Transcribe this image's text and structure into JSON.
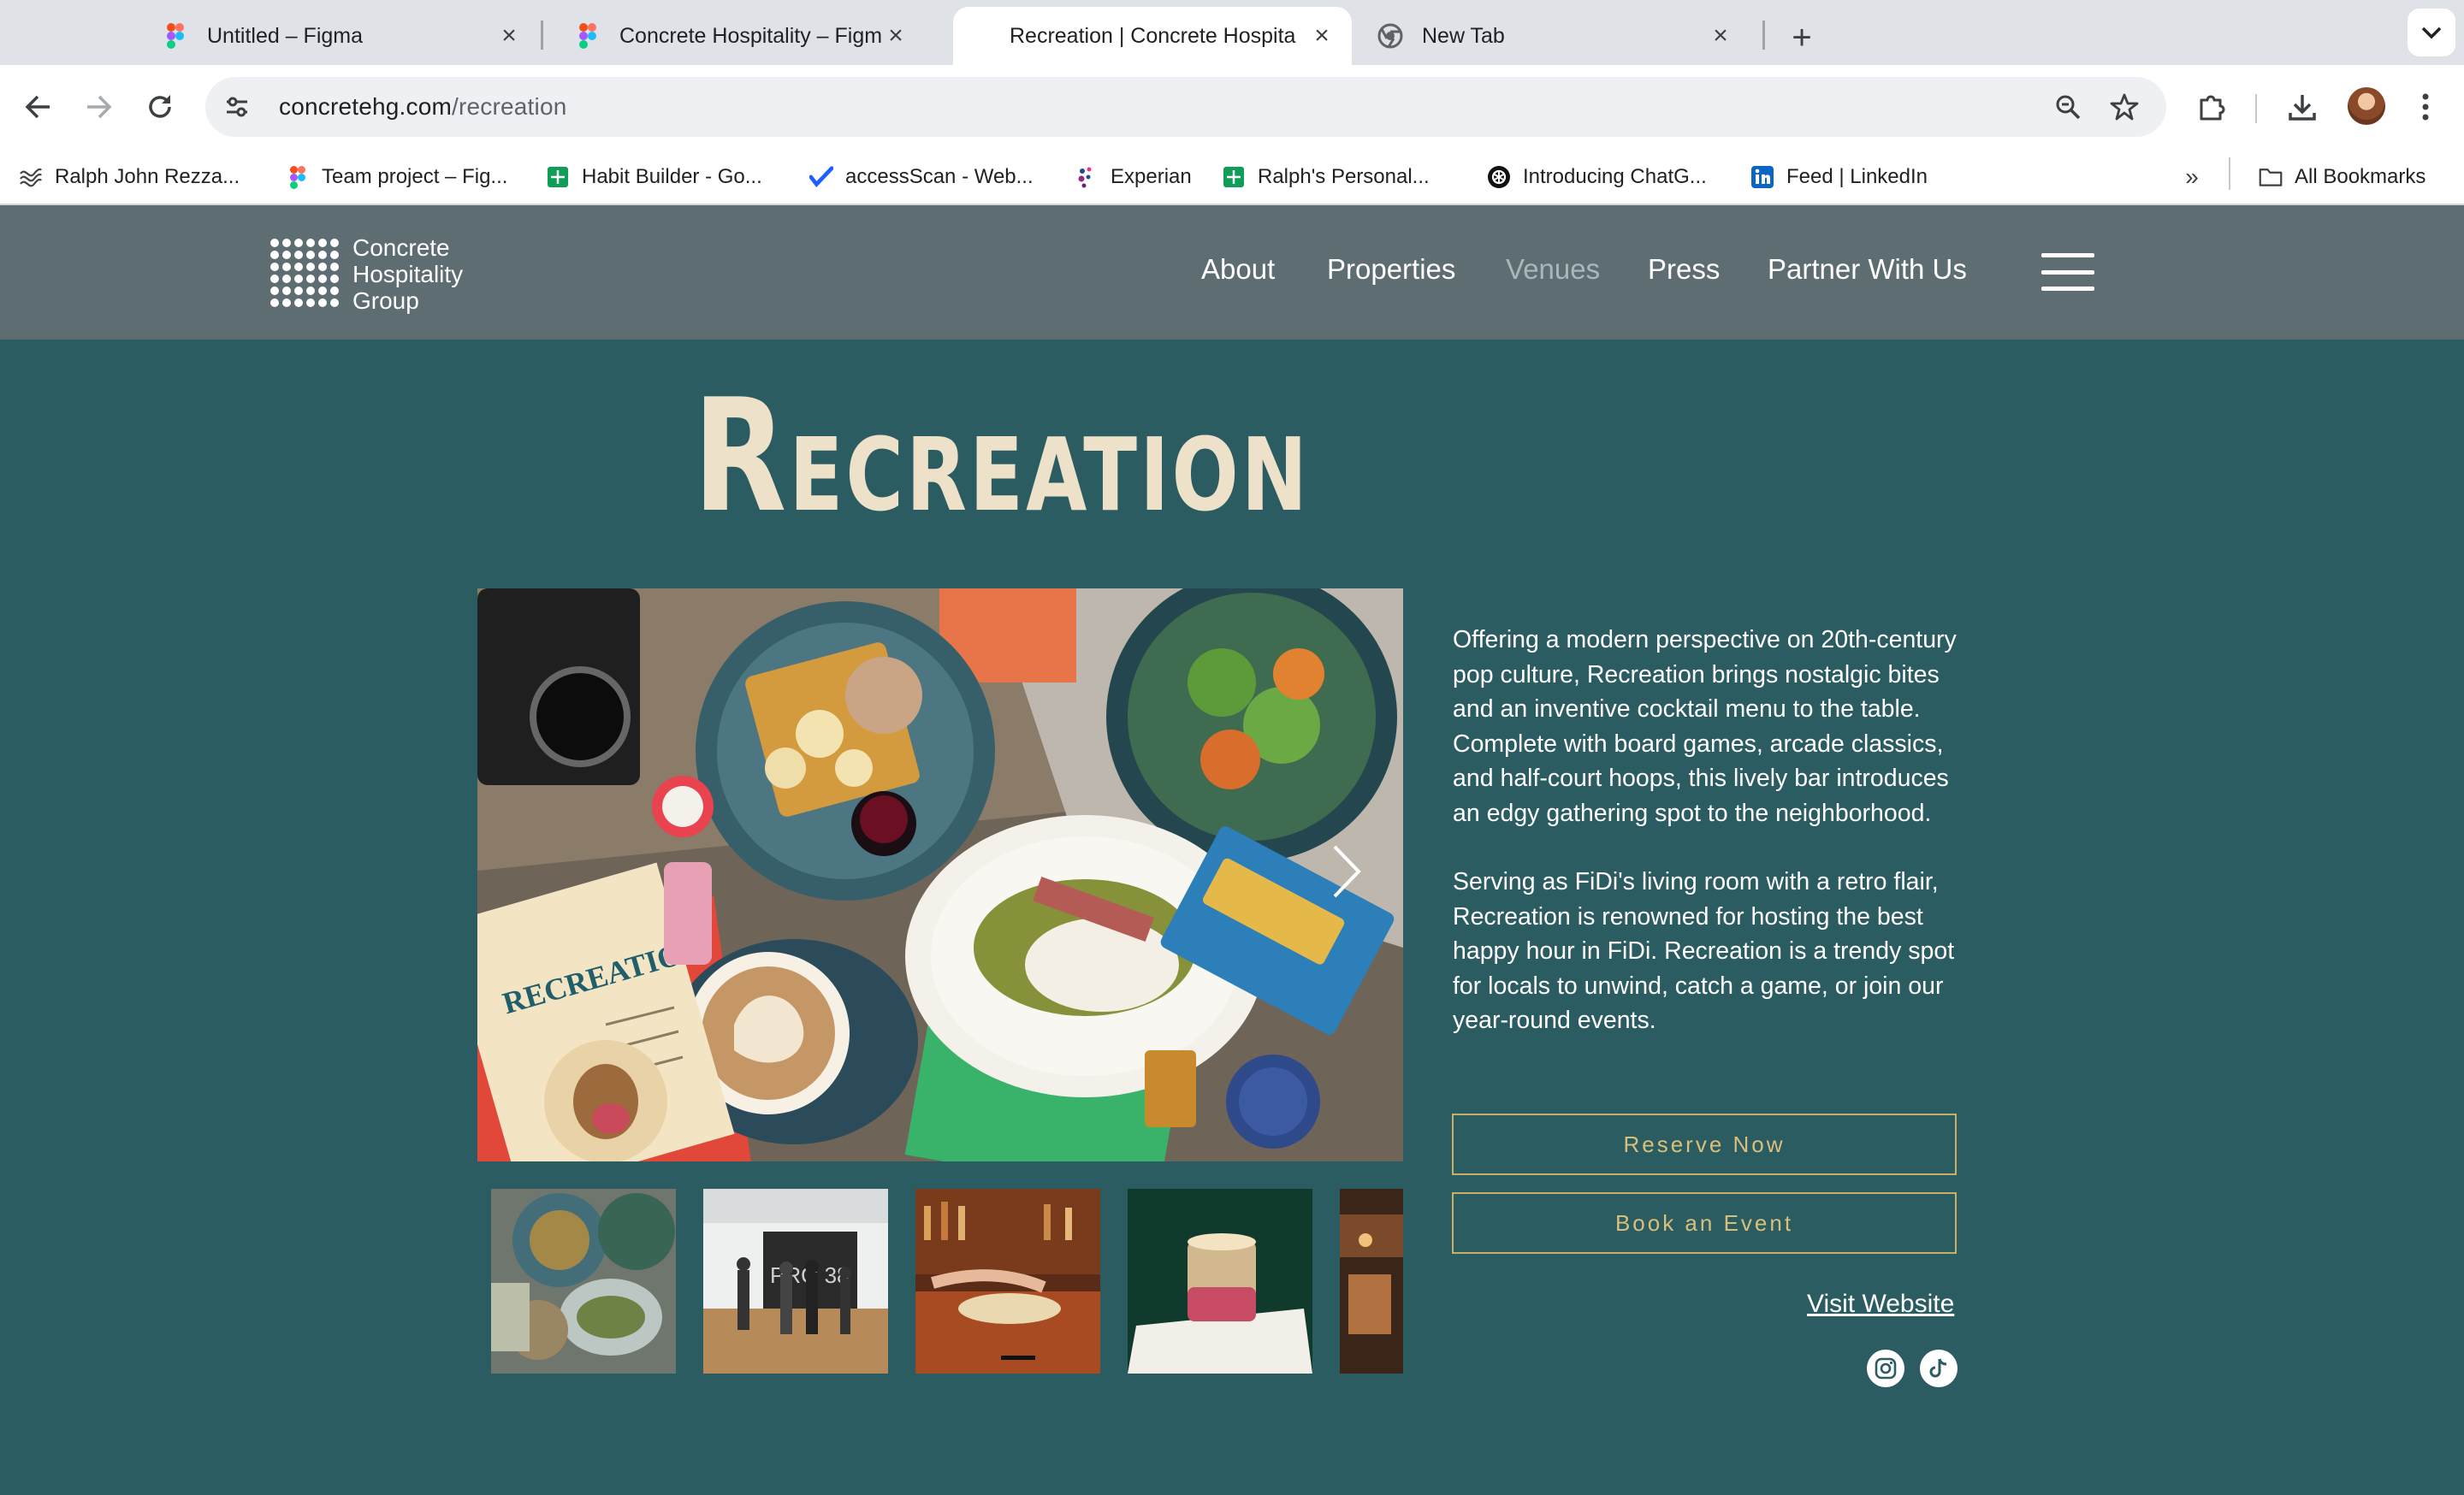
{
  "browser": {
    "tabs": [
      {
        "title": "Untitled – Figma",
        "icon": "figma-icon",
        "active": false
      },
      {
        "title": "Concrete Hospitality – Figma",
        "icon": "figma-icon",
        "active": false
      },
      {
        "title": "Recreation | Concrete Hospita",
        "icon": "",
        "active": true
      },
      {
        "title": "New Tab",
        "icon": "chrome-icon",
        "active": false
      }
    ],
    "url_host": "concretehg.com",
    "url_path": "/recreation",
    "bookmarks": [
      {
        "label": "Ralph John Rezza...",
        "icon": "wave-icon"
      },
      {
        "label": "Team project – Fig...",
        "icon": "figma-icon"
      },
      {
        "label": "Habit Builder - Go...",
        "icon": "sheets-icon"
      },
      {
        "label": "accessScan - Web...",
        "icon": "accessscan-icon"
      },
      {
        "label": "Experian",
        "icon": "experian-icon"
      },
      {
        "label": "Ralph's Personal...",
        "icon": "sheets-icon"
      },
      {
        "label": "Introducing ChatG...",
        "icon": "openai-icon"
      },
      {
        "label": "Feed | LinkedIn",
        "icon": "linkedin-icon"
      }
    ],
    "all_bookmarks_label": "All Bookmarks"
  },
  "site": {
    "logo": {
      "line1": "Concrete",
      "line2": "Hospitality",
      "line3": "Group"
    },
    "nav": [
      {
        "label": "About",
        "current": false
      },
      {
        "label": "Properties",
        "current": false
      },
      {
        "label": "Venues",
        "current": true
      },
      {
        "label": "Press",
        "current": false
      },
      {
        "label": "Partner With Us",
        "current": false
      }
    ],
    "page_title_first": "R",
    "page_title_rest": "ECREATION",
    "description": [
      "Offering a modern perspective on 20th-century pop culture, Recreation brings nostalgic bites and an inventive cocktail menu to the table. Complete with board games, arcade classics, and half-court hoops, this lively bar introduces an edgy gathering spot to the neighborhood.",
      "Serving as FiDi's living room with a retro flair, Recreation is renowned for hosting the best happy hour in FiDi. Recreation is a trendy spot for locals to unwind, catch a game, or join our year-round events."
    ],
    "reserve_label": "Reserve Now",
    "book_event_label": "Book an Event",
    "visit_label": "Visit Website",
    "hero_menu_text": "RECREATION",
    "thumb_sign_text": "PRO 38",
    "colors": {
      "page_bg": "#2b5c61",
      "header_bg": "#5d6d72",
      "title": "#eee1c9",
      "cta_border": "#c9b06a",
      "cta_text": "#d8c07a",
      "nav_current": "#a9b7bb"
    }
  }
}
